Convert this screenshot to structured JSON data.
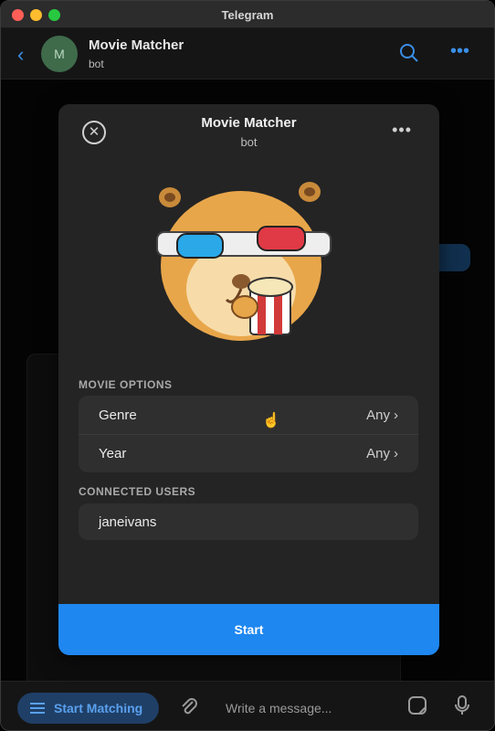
{
  "window": {
    "title": "Telegram"
  },
  "chat": {
    "name": "Movie Matcher",
    "status": "bot",
    "avatar_letter": "M"
  },
  "modal": {
    "title": "Movie Matcher",
    "subtitle": "bot",
    "sections": {
      "movie_options": {
        "label": "MOVIE OPTIONS",
        "rows": [
          {
            "label": "Genre",
            "value": "Any"
          },
          {
            "label": "Year",
            "value": "Any"
          }
        ]
      },
      "connected_users": {
        "label": "CONNECTED USERS",
        "users": [
          "janeivans"
        ]
      }
    },
    "start_label": "Start"
  },
  "composer": {
    "menu_button_label": "Start Matching",
    "placeholder": "Write a message..."
  },
  "icons": {
    "back": "chevron-left-icon",
    "search": "search-icon",
    "more": "more-icon",
    "close": "close-icon",
    "attach": "paperclip-icon",
    "sticker": "sticker-icon",
    "mic": "microphone-icon",
    "cursor": "hand-pointer-icon"
  },
  "colors": {
    "accent": "#1f87f0",
    "link": "#3a8ee6",
    "modal_bg": "#242424",
    "row_bg": "#2f2f2f"
  }
}
